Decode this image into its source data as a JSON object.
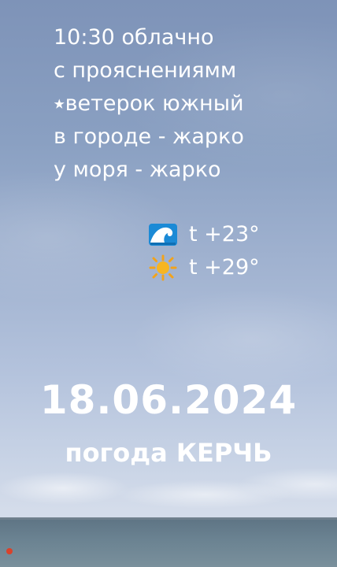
{
  "forecast": {
    "line1": "10:30 облачно",
    "line2": "с прояснениямм",
    "line3": "⭑ветерок южный",
    "line4": "в городе - жарко",
    "line5": "у моря - жарко"
  },
  "temperatures": {
    "sea_icon": "wave-icon",
    "sea": "t +23°",
    "city_icon": "sun-icon",
    "city": "t +29°"
  },
  "date": "18.06.2024",
  "subtitle": "погода КЕРЧЬ"
}
